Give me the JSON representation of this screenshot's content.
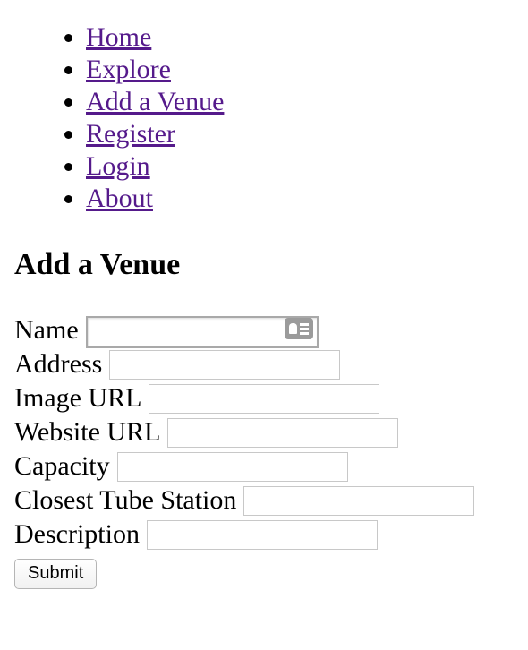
{
  "nav": {
    "items": [
      {
        "label": "Home"
      },
      {
        "label": "Explore"
      },
      {
        "label": "Add a Venue"
      },
      {
        "label": "Register"
      },
      {
        "label": "Login"
      },
      {
        "label": "About"
      }
    ],
    "link_color": "#551a8b"
  },
  "page": {
    "title": "Add a Venue"
  },
  "form": {
    "fields": [
      {
        "label": "Name",
        "value": "",
        "icon": "contact-card-icon"
      },
      {
        "label": "Address",
        "value": ""
      },
      {
        "label": "Image URL",
        "value": ""
      },
      {
        "label": "Website URL",
        "value": ""
      },
      {
        "label": "Capacity",
        "value": ""
      },
      {
        "label": "Closest Tube Station",
        "value": ""
      },
      {
        "label": "Description",
        "value": ""
      }
    ],
    "submit_label": "Submit"
  }
}
